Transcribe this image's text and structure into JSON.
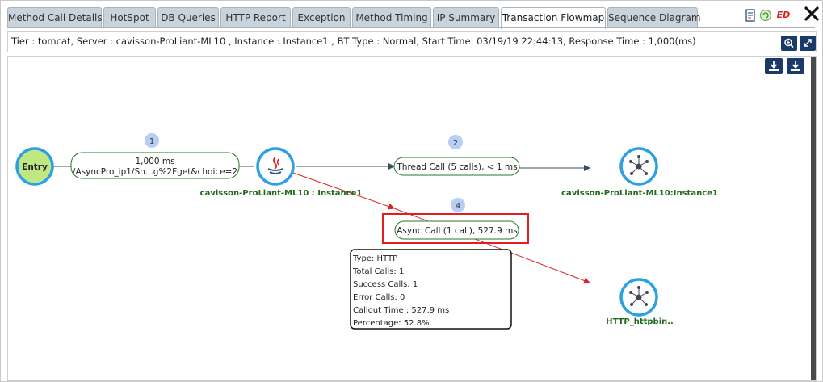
{
  "tabs": [
    {
      "label": "Method Call Details",
      "active": false
    },
    {
      "label": "HotSpot",
      "active": false
    },
    {
      "label": "DB Queries",
      "active": false
    },
    {
      "label": "HTTP Report",
      "active": false
    },
    {
      "label": "Exception",
      "active": false
    },
    {
      "label": "Method Timing",
      "active": false
    },
    {
      "label": "IP Summary",
      "active": false
    },
    {
      "label": "Transaction Flowmap",
      "active": true
    },
    {
      "label": "Sequence Diagram",
      "active": false
    }
  ],
  "top_icons": {
    "pdf": "pdf-icon",
    "refresh": "refresh-icon",
    "ed": "ED",
    "close": "close-icon"
  },
  "info": {
    "text": "Tier : tomcat,  Server : cavisson-ProLiant-ML10 ,  Instance : Instance1 ,  BT Type : Normal, Start Time: 03/19/19 22:44:13, Response Time : 1,000(ms)"
  },
  "flowmap": {
    "entry_label": "Entry",
    "edge_entry": {
      "line1": "1,000 ms",
      "line2": "/AsyncPro_ip1/Sh...g%2Fget&choice=2",
      "badge": "1"
    },
    "java_node_label": "cavisson-ProLiant-ML10 : Instance1",
    "thread_call": {
      "label": "Thread Call (5 calls), < 1 ms",
      "badge": "2"
    },
    "thread_target_label": "cavisson-ProLiant-ML10:Instance1",
    "async_call": {
      "label": "Async Call (1 call), 527.9 ms",
      "badge": "4"
    },
    "http_node_label": "HTTP_httpbin..",
    "tooltip": [
      "Type: HTTP",
      "Total Calls: 1",
      "Success Calls: 1",
      "Error Calls: 0",
      "Callout Time : 527.9 ms",
      "Percentage: 52.8%"
    ]
  },
  "colors": {
    "tab_bg": "#c9d3db",
    "navy": "#1b3a69",
    "node_ring": "#2aa0e8",
    "entry_fill": "#bfe883",
    "edge_green": "#2a7a2a",
    "async_red": "#e02020",
    "label_green": "#1e6b1e"
  }
}
